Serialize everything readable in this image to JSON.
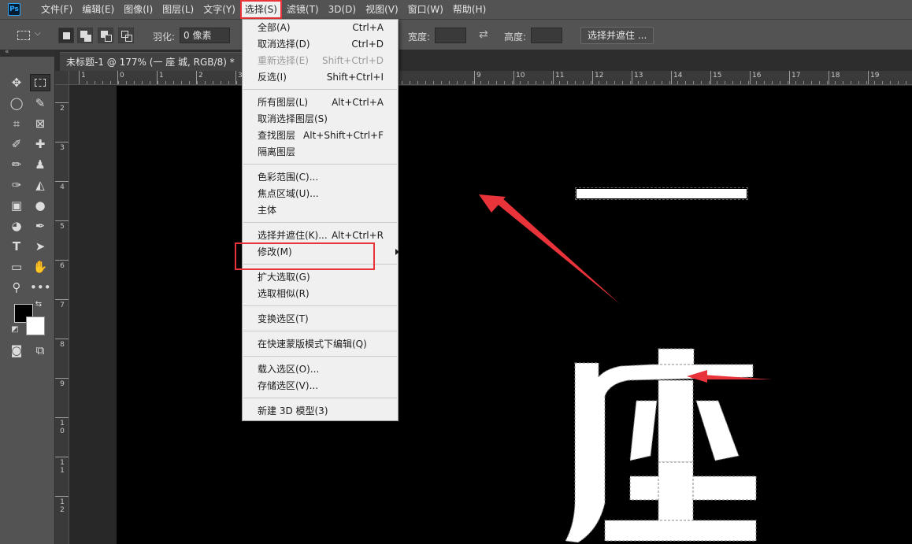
{
  "menubar": {
    "items": [
      "文件(F)",
      "编辑(E)",
      "图像(I)",
      "图层(L)",
      "文字(Y)",
      "选择(S)",
      "滤镜(T)",
      "3D(D)",
      "视图(V)",
      "窗口(W)",
      "帮助(H)"
    ],
    "active_index": 5,
    "logo": "Ps"
  },
  "options": {
    "feather_label": "羽化:",
    "feather_value": "0 像素",
    "width_label": "宽度:",
    "height_label": "高度:",
    "refine_button": "选择并遮住 ..."
  },
  "document": {
    "tab_title": "未标题-1 @ 177% (一 座 城, RGB/8) *",
    "close": "×"
  },
  "select_menu": {
    "items": [
      {
        "label": "全部(A)",
        "shortcut": "Ctrl+A"
      },
      {
        "label": "取消选择(D)",
        "shortcut": "Ctrl+D"
      },
      {
        "label": "重新选择(E)",
        "shortcut": "Shift+Ctrl+D",
        "disabled": true
      },
      {
        "label": "反选(I)",
        "shortcut": "Shift+Ctrl+I"
      },
      {
        "label": "所有图层(L)",
        "shortcut": "Alt+Ctrl+A"
      },
      {
        "label": "取消选择图层(S)",
        "shortcut": ""
      },
      {
        "label": "查找图层",
        "shortcut": "Alt+Shift+Ctrl+F"
      },
      {
        "label": "隔离图层",
        "shortcut": ""
      },
      {
        "label": "色彩范围(C)...",
        "shortcut": ""
      },
      {
        "label": "焦点区域(U)...",
        "shortcut": ""
      },
      {
        "label": "主体",
        "shortcut": ""
      },
      {
        "label": "选择并遮住(K)...",
        "shortcut": "Alt+Ctrl+R"
      },
      {
        "label": "修改(M)",
        "shortcut": "",
        "submenu": true
      },
      {
        "label": "扩大选取(G)",
        "shortcut": ""
      },
      {
        "label": "选取相似(R)",
        "shortcut": ""
      },
      {
        "label": "变换选区(T)",
        "shortcut": ""
      },
      {
        "label": "在快速蒙版模式下编辑(Q)",
        "shortcut": ""
      },
      {
        "label": "载入选区(O)...",
        "shortcut": ""
      },
      {
        "label": "存储选区(V)...",
        "shortcut": ""
      },
      {
        "label": "新建 3D 模型(3)",
        "shortcut": ""
      }
    ]
  },
  "ruler_top": [
    "1",
    "0",
    "1",
    "2",
    "3",
    "9",
    "10",
    "11",
    "12",
    "13",
    "14",
    "15",
    "16",
    "17",
    "18",
    "19"
  ],
  "ruler_left": [
    "2",
    "3",
    "4",
    "5",
    "6",
    "7",
    "8",
    "9",
    "1\n0",
    "1\n1",
    "1\n2"
  ],
  "canvas_text": [
    "一",
    "座"
  ],
  "colors": {
    "accent_red": "#e8333a",
    "menu_bg": "#f0f0f0",
    "chrome": "#535353"
  }
}
